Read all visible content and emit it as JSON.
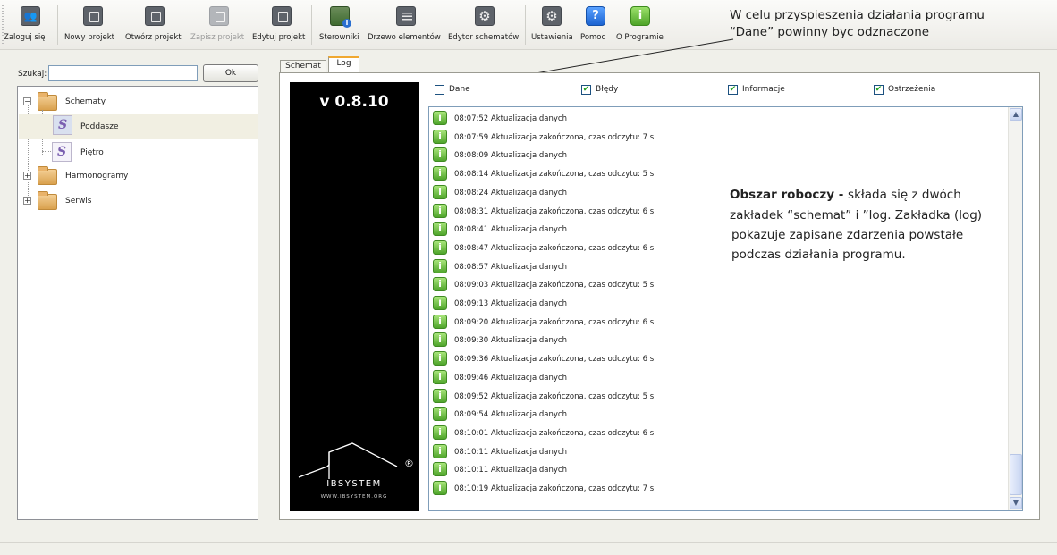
{
  "toolbar": {
    "items": [
      {
        "label": "Zaloguj się",
        "icon": "user-login-icon",
        "enabled": true
      },
      {
        "label": "Nowy projekt",
        "icon": "new-project-icon",
        "enabled": true
      },
      {
        "label": "Otwórz projekt",
        "icon": "open-project-icon",
        "enabled": true
      },
      {
        "label": "Zapisz projekt",
        "icon": "save-project-icon",
        "enabled": false
      },
      {
        "label": "Edytuj projekt",
        "icon": "edit-project-icon",
        "enabled": true
      },
      {
        "label": "Sterowniki",
        "icon": "controllers-icon",
        "enabled": true
      },
      {
        "label": "Drzewo elementów",
        "icon": "element-tree-icon",
        "enabled": true
      },
      {
        "label": "Edytor schematów",
        "icon": "schema-editor-icon",
        "enabled": true
      },
      {
        "label": "Ustawienia",
        "icon": "settings-icon",
        "enabled": true
      },
      {
        "label": "Pomoc",
        "icon": "help-icon",
        "enabled": true
      },
      {
        "label": "O Programie",
        "icon": "about-icon",
        "enabled": true
      }
    ]
  },
  "annotations": {
    "top_line1": "W celu przyspieszenia działania programu",
    "top_line2": "“Dane” powinny byc odznaczone",
    "work_bold": "Obszar roboczy - ",
    "work_rest": "składa się z dwóch",
    "work_line2": "zakładek “schemat” i ”log. Zakładka (log)",
    "work_line3": "pokazuje zapisane zdarzenia powstałe",
    "work_line4": "podczas działania programu."
  },
  "search": {
    "label": "Szukaj:",
    "value": "",
    "ok_label": "Ok"
  },
  "tree": {
    "root": "Schematy",
    "children": [
      "Poddasze",
      "Piętro"
    ],
    "others": [
      "Harmonogramy",
      "Serwis"
    ],
    "selected": "Poddasze"
  },
  "tabs": [
    {
      "label": "Schemat",
      "active": false
    },
    {
      "label": "Log",
      "active": true
    }
  ],
  "logo": {
    "version": "v 0.8.10",
    "brand": "IBSYSTEM",
    "url": "WWW.IBSYSTEM.ORG",
    "registered": "®"
  },
  "filters": [
    {
      "label": "Dane",
      "checked": false
    },
    {
      "label": "Błędy",
      "checked": true
    },
    {
      "label": "Informacje",
      "checked": true
    },
    {
      "label": "Ostrzeżenia",
      "checked": true
    }
  ],
  "log_entries": [
    "08:07:52 Aktualizacja danych",
    "08:07:59 Aktualizacja zakończona, czas odczytu: 7 s",
    "08:08:09 Aktualizacja danych",
    "08:08:14 Aktualizacja zakończona, czas odczytu: 5 s",
    "08:08:24 Aktualizacja danych",
    "08:08:31 Aktualizacja zakończona, czas odczytu: 6 s",
    "08:08:41 Aktualizacja danych",
    "08:08:47 Aktualizacja zakończona, czas odczytu: 6 s",
    "08:08:57 Aktualizacja danych",
    "08:09:03 Aktualizacja zakończona, czas odczytu: 5 s",
    "08:09:13 Aktualizacja danych",
    "08:09:20 Aktualizacja zakończona, czas odczytu: 6 s",
    "08:09:30 Aktualizacja danych",
    "08:09:36 Aktualizacja zakończona, czas odczytu: 6 s",
    "08:09:46 Aktualizacja danych",
    "08:09:52 Aktualizacja zakończona, czas odczytu: 5 s",
    "08:09:54 Aktualizacja danych",
    "08:10:01 Aktualizacja zakończona, czas odczytu: 6 s",
    "08:10:11 Aktualizacja danych",
    "08:10:11 Aktualizacja danych",
    "08:10:19 Aktualizacja zakończona, czas odczytu: 7 s"
  ],
  "scroll_position": 1.0
}
